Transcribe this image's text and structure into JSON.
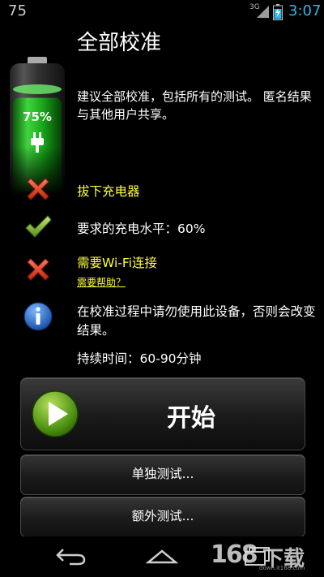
{
  "status_bar": {
    "left_number": "75",
    "network": "3G",
    "time": "3:07"
  },
  "title": "全部校准",
  "battery": {
    "percent_label": "75%",
    "level": 0.75
  },
  "description": "建议全部校准，包括所有的测试。 匿名结果与其他用户共享。",
  "requirements": [
    {
      "icon": "cross-icon",
      "text": "拔下充电器",
      "highlight": true
    },
    {
      "icon": "check-icon",
      "text": "要求的充电水平：60%",
      "highlight": false
    },
    {
      "icon": "cross-icon",
      "text": "需要Wi-Fi连接",
      "highlight": true
    }
  ],
  "help_link": "需要帮助？",
  "info_text": "在校准过程中请勿使用此设备，否则会改变结果。",
  "duration": "持续时间：60-90分钟",
  "buttons": {
    "start": "开始",
    "single_test": "单独测试...",
    "extra_test": "额外测试..."
  },
  "watermark": {
    "main": "下载",
    "digits": "168",
    "sub": "down.it168.com"
  }
}
